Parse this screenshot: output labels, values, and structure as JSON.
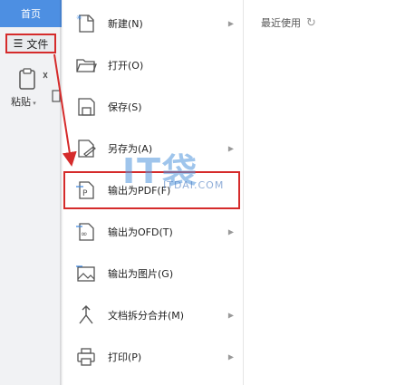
{
  "tabs": {
    "home": "首页"
  },
  "file_button": {
    "label": "文件"
  },
  "clipboard": {
    "paste_label": "粘贴"
  },
  "menu": {
    "items": [
      {
        "label": "新建(N)",
        "icon": "new-document-icon",
        "has_submenu": true
      },
      {
        "label": "打开(O)",
        "icon": "folder-open-icon",
        "has_submenu": false
      },
      {
        "label": "保存(S)",
        "icon": "save-icon",
        "has_submenu": false
      },
      {
        "label": "另存为(A)",
        "icon": "save-as-icon",
        "has_submenu": true
      },
      {
        "label": "输出为PDF(F)",
        "icon": "export-pdf-icon",
        "has_submenu": false
      },
      {
        "label": "输出为OFD(T)",
        "icon": "export-ofd-icon",
        "has_submenu": true
      },
      {
        "label": "输出为图片(G)",
        "icon": "export-image-icon",
        "has_submenu": false
      },
      {
        "label": "文档拆分合并(M)",
        "icon": "split-merge-icon",
        "has_submenu": true
      },
      {
        "label": "打印(P)",
        "icon": "printer-icon",
        "has_submenu": true
      }
    ]
  },
  "recent": {
    "label": "最近使用"
  },
  "watermark": {
    "text": "IT袋",
    "url": "ITDAI.COM"
  },
  "colors": {
    "accent": "#4d8fe2",
    "highlight": "#d52b2b"
  }
}
